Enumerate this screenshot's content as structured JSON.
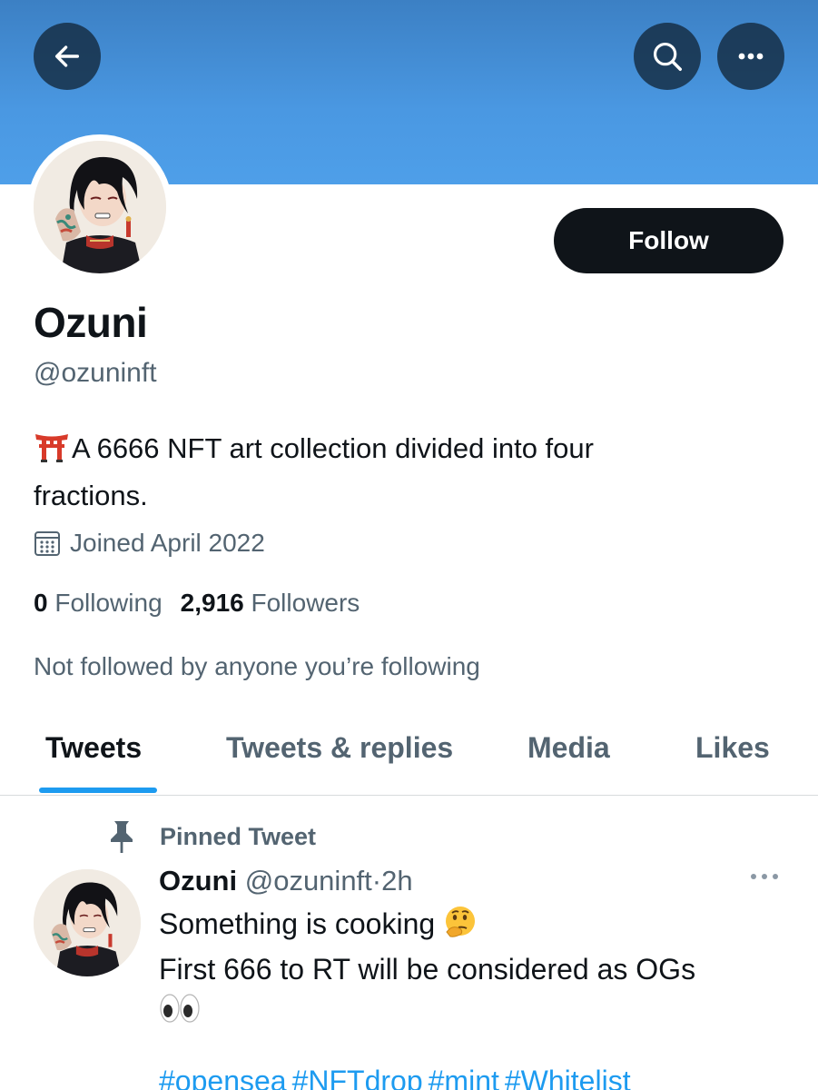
{
  "header": {
    "back_icon": "arrow-left-icon",
    "search_icon": "search-icon",
    "more_icon": "more-horizontal-icon",
    "banner_color": "#4a98e2"
  },
  "profile": {
    "display_name": "Ozuni",
    "handle": "@ozuninft",
    "follow_label": "Follow",
    "bio_emoji": "torii-gate-emoji",
    "bio_line1": "A 6666 NFT art collection divided into four",
    "bio_line2": "fractions.",
    "joined_icon": "calendar-icon",
    "joined": "Joined April 2022",
    "following_count": "0",
    "following_label": "Following",
    "followers_count": "2,916",
    "followers_label": "Followers",
    "mutuals": "Not followed by anyone you’re following"
  },
  "tabs": [
    {
      "label": "Tweets",
      "active": true
    },
    {
      "label": "Tweets & replies",
      "active": false
    },
    {
      "label": "Media",
      "active": false
    },
    {
      "label": "Likes",
      "active": false
    }
  ],
  "pinned_tweet": {
    "pin_icon": "pin-icon",
    "pinned_label": "Pinned Tweet",
    "author_name": "Ozuni",
    "author_handle": "@ozuninft",
    "separator": "·",
    "time": "2h",
    "more_icon": "more-horizontal-icon",
    "text_line1": "Something is cooking",
    "text_line1_emoji": "thinking-face-emoji",
    "text_line2": "First 666 to RT will be considered as OGs",
    "text_line3_emoji": "eyes-emoji",
    "hashtags": [
      "#opensea",
      "#NFTdrop",
      "#mint",
      "#Whitelist"
    ]
  },
  "colors": {
    "accent": "#1d9bf0",
    "text_primary": "#0f1419",
    "text_secondary": "#536471",
    "button_dark": "#0f1419"
  }
}
